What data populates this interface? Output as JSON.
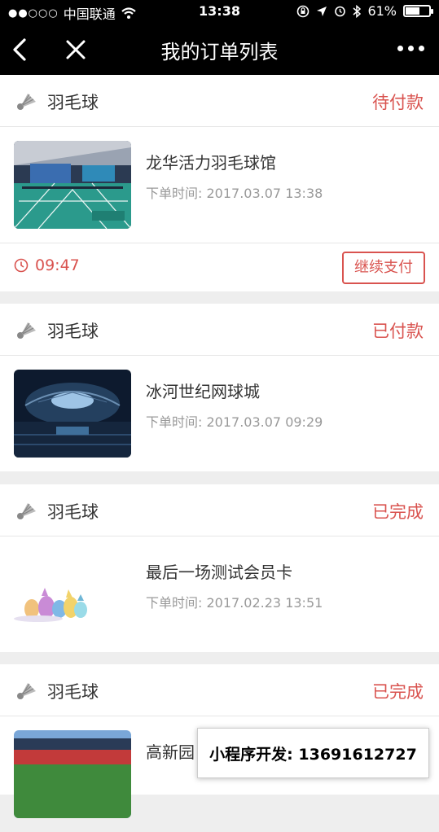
{
  "status_bar": {
    "signal": "●●○○○",
    "carrier": "中国联通",
    "time": "13:38",
    "battery": "61%",
    "battery_level": 0.61
  },
  "nav": {
    "title": "我的订单列表",
    "back_icon": "chevron-left-icon",
    "close_icon": "close-icon",
    "more_icon": "more-dots-icon"
  },
  "colors": {
    "accent": "#d9534f",
    "nav_bg": "#000000",
    "page_bg": "#eeeeee"
  },
  "orders": [
    {
      "sport": "羽毛球",
      "status": "待付款",
      "venue": "龙华活力羽毛球馆",
      "time_label": "下单时间:",
      "time": "2017.03.07 13:38",
      "countdown": "09:47",
      "action": "继续支付"
    },
    {
      "sport": "羽毛球",
      "status": "已付款",
      "venue": "冰河世纪网球城",
      "time_label": "下单时间:",
      "time": "2017.03.07 09:29"
    },
    {
      "sport": "羽毛球",
      "status": "已完成",
      "venue": "最后一场测试会员卡",
      "time_label": "下单时间:",
      "time": "2017.02.23 13:51"
    },
    {
      "sport": "羽毛球",
      "status": "已完成",
      "venue": "高新园"
    }
  ],
  "watermark": "小程序开发: 13691612727"
}
